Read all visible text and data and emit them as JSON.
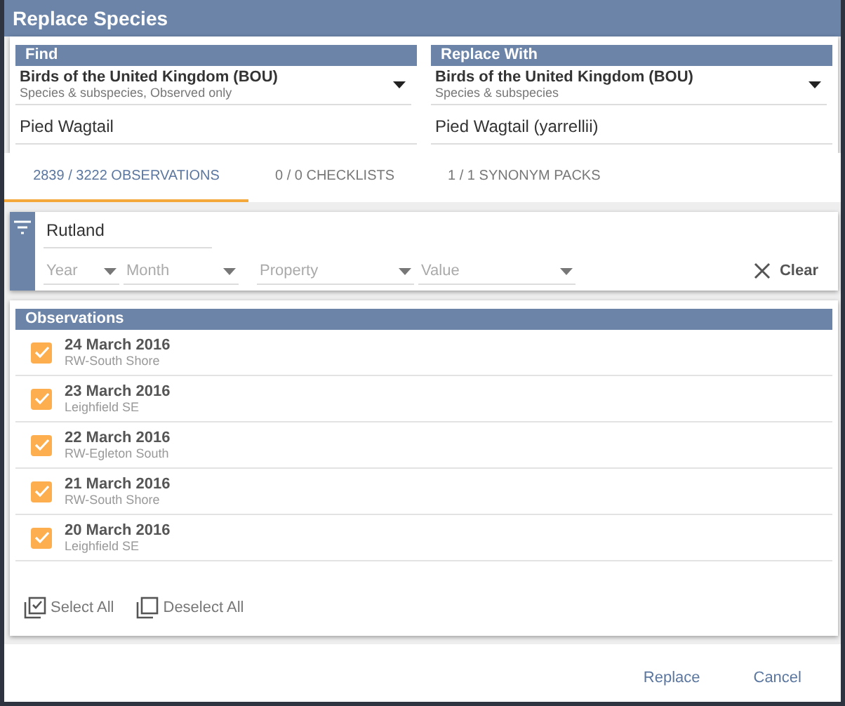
{
  "window": {
    "title": "Replace Species"
  },
  "find": {
    "heading": "Find",
    "checklist": "Birds of the United Kingdom (BOU)",
    "checklist_note": "Species & subspecies, Observed only",
    "species": "Pied Wagtail"
  },
  "replace_with": {
    "heading": "Replace With",
    "checklist": "Birds of the United Kingdom (BOU)",
    "checklist_note": "Species & subspecies",
    "species": "Pied Wagtail (yarrellii)"
  },
  "tabs": [
    {
      "label": "2839 / 3222 OBSERVATIONS",
      "selected": true
    },
    {
      "label": "0 / 0 CHECKLISTS",
      "selected": false
    },
    {
      "label": "1 / 1 SYNONYM PACKS",
      "selected": false
    }
  ],
  "filter": {
    "location": "Rutland",
    "dropdowns": [
      {
        "placeholder": "Year"
      },
      {
        "placeholder": "Month"
      },
      {
        "placeholder": "Property"
      },
      {
        "placeholder": "Value"
      }
    ],
    "clear": "Clear"
  },
  "observations": {
    "heading": "Observations",
    "rows": [
      {
        "date": "24 March 2016",
        "place": "RW-South Shore",
        "checked": true
      },
      {
        "date": "23 March 2016",
        "place": "Leighfield SE",
        "checked": true
      },
      {
        "date": "22 March 2016",
        "place": "RW-Egleton South",
        "checked": true
      },
      {
        "date": "21 March 2016",
        "place": "RW-South Shore",
        "checked": true
      },
      {
        "date": "20 March 2016",
        "place": "Leighfield SE",
        "checked": true
      }
    ],
    "select_all": "Select All",
    "deselect_all": "Deselect All"
  },
  "buttons": [
    "Replace",
    "Cancel"
  ]
}
